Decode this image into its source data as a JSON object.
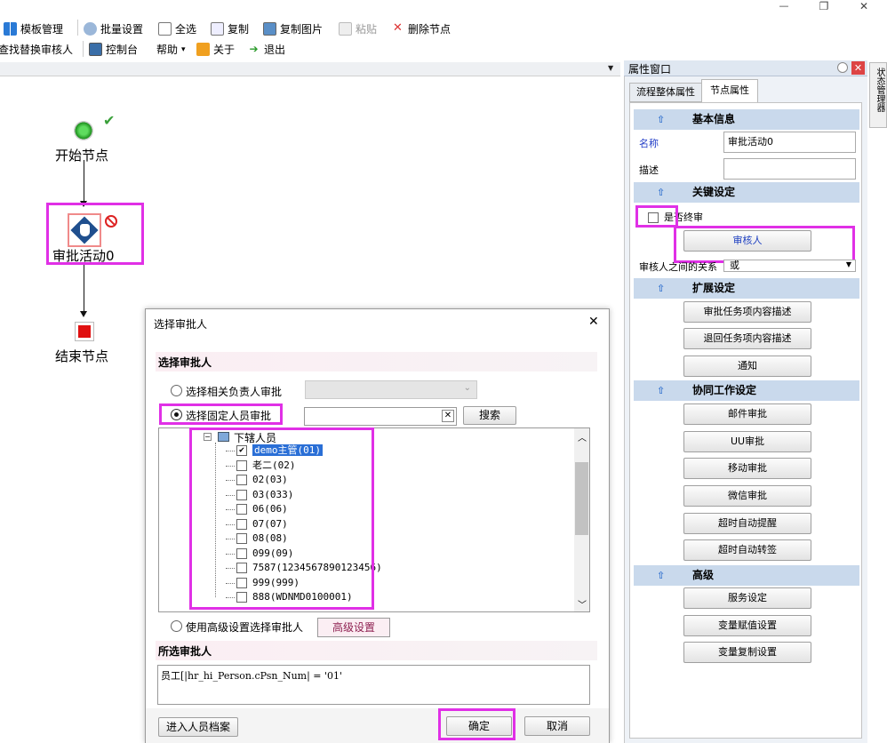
{
  "window": {
    "minimize": "—",
    "maximize": "❐",
    "close": "✕"
  },
  "toolbar": {
    "row1": [
      "模板管理",
      "批量设置",
      "全选",
      "复制",
      "复制图片",
      "粘贴",
      "删除节点"
    ],
    "row2": [
      "查找替换审核人",
      "控制台",
      "帮助",
      "关于",
      "退出"
    ],
    "help_arrow": "▾"
  },
  "canvas": {
    "start_label": "开始节点",
    "approval_label": "审批活动0",
    "end_label": "结束节点",
    "dropdown_glyph": "▼"
  },
  "props": {
    "title": "属性窗口",
    "tabs": [
      "流程整体属性",
      "节点属性"
    ],
    "side_tab": "状态管理器",
    "sections": {
      "basic": "基本信息",
      "key": "关键设定",
      "ext": "扩展设定",
      "collab": "协同工作设定",
      "adv": "高级"
    },
    "name_label": "名称",
    "name_value": "审批活动0",
    "desc_label": "描述",
    "desc_value": "",
    "final_label": "是否终审",
    "approver_button": "审核人",
    "relation_label": "审核人之间的关系",
    "relation_value": "或",
    "ext_buttons": [
      "审批任务项内容描述",
      "退回任务项内容描述",
      "通知"
    ],
    "collab_buttons": [
      "邮件审批",
      "UU审批",
      "移动审批",
      "微信审批",
      "超时自动提醒",
      "超时自动转签"
    ],
    "adv_buttons": [
      "服务设定",
      "变量赋值设置",
      "变量复制设置"
    ]
  },
  "dialog": {
    "title": "选择审批人",
    "close": "✕",
    "heading": "选择审批人",
    "opt_related": "选择相关负责人审批",
    "opt_fixed": "选择固定人员审批",
    "search_value": "",
    "search_clear": "✕",
    "search_button": "搜索",
    "tree_root": "下辖人员",
    "tree_items": [
      {
        "label": "demo主管(01)",
        "checked": true,
        "selected": true
      },
      {
        "label": "老二(02)",
        "checked": false
      },
      {
        "label": "02(03)",
        "checked": false
      },
      {
        "label": "03(033)",
        "checked": false
      },
      {
        "label": "06(06)",
        "checked": false
      },
      {
        "label": "07(07)",
        "checked": false
      },
      {
        "label": "08(08)",
        "checked": false
      },
      {
        "label": "099(09)",
        "checked": false
      },
      {
        "label": "7587(1234567890123456)",
        "checked": false
      },
      {
        "label": "999(999)",
        "checked": false
      },
      {
        "label": "888(WDNMD0100001)",
        "checked": false
      }
    ],
    "opt_advanced": "使用高级设置选择审批人",
    "advanced_button": "高级设置",
    "selected_heading": "所选审批人",
    "selected_value": "员工[|hr_hi_Person.cPsn_Num| = '01'",
    "archive_button": "进入人员档案",
    "ok_button": "确定",
    "cancel_button": "取消"
  }
}
